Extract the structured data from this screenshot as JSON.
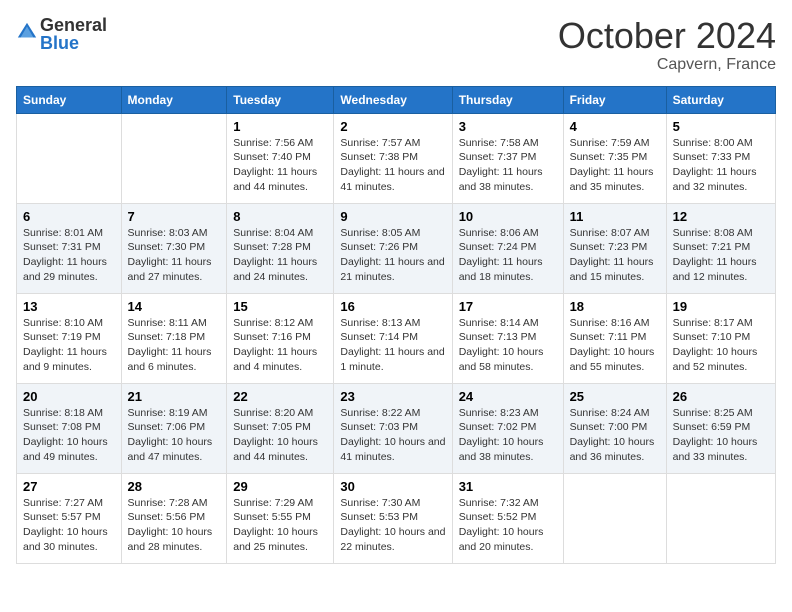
{
  "header": {
    "logo_general": "General",
    "logo_blue": "Blue",
    "month_title": "October 2024",
    "location": "Capvern, France"
  },
  "days_of_week": [
    "Sunday",
    "Monday",
    "Tuesday",
    "Wednesday",
    "Thursday",
    "Friday",
    "Saturday"
  ],
  "weeks": [
    [
      {
        "day": "",
        "sunrise": "",
        "sunset": "",
        "daylight": ""
      },
      {
        "day": "",
        "sunrise": "",
        "sunset": "",
        "daylight": ""
      },
      {
        "day": "1",
        "sunrise": "Sunrise: 7:56 AM",
        "sunset": "Sunset: 7:40 PM",
        "daylight": "Daylight: 11 hours and 44 minutes."
      },
      {
        "day": "2",
        "sunrise": "Sunrise: 7:57 AM",
        "sunset": "Sunset: 7:38 PM",
        "daylight": "Daylight: 11 hours and 41 minutes."
      },
      {
        "day": "3",
        "sunrise": "Sunrise: 7:58 AM",
        "sunset": "Sunset: 7:37 PM",
        "daylight": "Daylight: 11 hours and 38 minutes."
      },
      {
        "day": "4",
        "sunrise": "Sunrise: 7:59 AM",
        "sunset": "Sunset: 7:35 PM",
        "daylight": "Daylight: 11 hours and 35 minutes."
      },
      {
        "day": "5",
        "sunrise": "Sunrise: 8:00 AM",
        "sunset": "Sunset: 7:33 PM",
        "daylight": "Daylight: 11 hours and 32 minutes."
      }
    ],
    [
      {
        "day": "6",
        "sunrise": "Sunrise: 8:01 AM",
        "sunset": "Sunset: 7:31 PM",
        "daylight": "Daylight: 11 hours and 29 minutes."
      },
      {
        "day": "7",
        "sunrise": "Sunrise: 8:03 AM",
        "sunset": "Sunset: 7:30 PM",
        "daylight": "Daylight: 11 hours and 27 minutes."
      },
      {
        "day": "8",
        "sunrise": "Sunrise: 8:04 AM",
        "sunset": "Sunset: 7:28 PM",
        "daylight": "Daylight: 11 hours and 24 minutes."
      },
      {
        "day": "9",
        "sunrise": "Sunrise: 8:05 AM",
        "sunset": "Sunset: 7:26 PM",
        "daylight": "Daylight: 11 hours and 21 minutes."
      },
      {
        "day": "10",
        "sunrise": "Sunrise: 8:06 AM",
        "sunset": "Sunset: 7:24 PM",
        "daylight": "Daylight: 11 hours and 18 minutes."
      },
      {
        "day": "11",
        "sunrise": "Sunrise: 8:07 AM",
        "sunset": "Sunset: 7:23 PM",
        "daylight": "Daylight: 11 hours and 15 minutes."
      },
      {
        "day": "12",
        "sunrise": "Sunrise: 8:08 AM",
        "sunset": "Sunset: 7:21 PM",
        "daylight": "Daylight: 11 hours and 12 minutes."
      }
    ],
    [
      {
        "day": "13",
        "sunrise": "Sunrise: 8:10 AM",
        "sunset": "Sunset: 7:19 PM",
        "daylight": "Daylight: 11 hours and 9 minutes."
      },
      {
        "day": "14",
        "sunrise": "Sunrise: 8:11 AM",
        "sunset": "Sunset: 7:18 PM",
        "daylight": "Daylight: 11 hours and 6 minutes."
      },
      {
        "day": "15",
        "sunrise": "Sunrise: 8:12 AM",
        "sunset": "Sunset: 7:16 PM",
        "daylight": "Daylight: 11 hours and 4 minutes."
      },
      {
        "day": "16",
        "sunrise": "Sunrise: 8:13 AM",
        "sunset": "Sunset: 7:14 PM",
        "daylight": "Daylight: 11 hours and 1 minute."
      },
      {
        "day": "17",
        "sunrise": "Sunrise: 8:14 AM",
        "sunset": "Sunset: 7:13 PM",
        "daylight": "Daylight: 10 hours and 58 minutes."
      },
      {
        "day": "18",
        "sunrise": "Sunrise: 8:16 AM",
        "sunset": "Sunset: 7:11 PM",
        "daylight": "Daylight: 10 hours and 55 minutes."
      },
      {
        "day": "19",
        "sunrise": "Sunrise: 8:17 AM",
        "sunset": "Sunset: 7:10 PM",
        "daylight": "Daylight: 10 hours and 52 minutes."
      }
    ],
    [
      {
        "day": "20",
        "sunrise": "Sunrise: 8:18 AM",
        "sunset": "Sunset: 7:08 PM",
        "daylight": "Daylight: 10 hours and 49 minutes."
      },
      {
        "day": "21",
        "sunrise": "Sunrise: 8:19 AM",
        "sunset": "Sunset: 7:06 PM",
        "daylight": "Daylight: 10 hours and 47 minutes."
      },
      {
        "day": "22",
        "sunrise": "Sunrise: 8:20 AM",
        "sunset": "Sunset: 7:05 PM",
        "daylight": "Daylight: 10 hours and 44 minutes."
      },
      {
        "day": "23",
        "sunrise": "Sunrise: 8:22 AM",
        "sunset": "Sunset: 7:03 PM",
        "daylight": "Daylight: 10 hours and 41 minutes."
      },
      {
        "day": "24",
        "sunrise": "Sunrise: 8:23 AM",
        "sunset": "Sunset: 7:02 PM",
        "daylight": "Daylight: 10 hours and 38 minutes."
      },
      {
        "day": "25",
        "sunrise": "Sunrise: 8:24 AM",
        "sunset": "Sunset: 7:00 PM",
        "daylight": "Daylight: 10 hours and 36 minutes."
      },
      {
        "day": "26",
        "sunrise": "Sunrise: 8:25 AM",
        "sunset": "Sunset: 6:59 PM",
        "daylight": "Daylight: 10 hours and 33 minutes."
      }
    ],
    [
      {
        "day": "27",
        "sunrise": "Sunrise: 7:27 AM",
        "sunset": "Sunset: 5:57 PM",
        "daylight": "Daylight: 10 hours and 30 minutes."
      },
      {
        "day": "28",
        "sunrise": "Sunrise: 7:28 AM",
        "sunset": "Sunset: 5:56 PM",
        "daylight": "Daylight: 10 hours and 28 minutes."
      },
      {
        "day": "29",
        "sunrise": "Sunrise: 7:29 AM",
        "sunset": "Sunset: 5:55 PM",
        "daylight": "Daylight: 10 hours and 25 minutes."
      },
      {
        "day": "30",
        "sunrise": "Sunrise: 7:30 AM",
        "sunset": "Sunset: 5:53 PM",
        "daylight": "Daylight: 10 hours and 22 minutes."
      },
      {
        "day": "31",
        "sunrise": "Sunrise: 7:32 AM",
        "sunset": "Sunset: 5:52 PM",
        "daylight": "Daylight: 10 hours and 20 minutes."
      },
      {
        "day": "",
        "sunrise": "",
        "sunset": "",
        "daylight": ""
      },
      {
        "day": "",
        "sunrise": "",
        "sunset": "",
        "daylight": ""
      }
    ]
  ]
}
